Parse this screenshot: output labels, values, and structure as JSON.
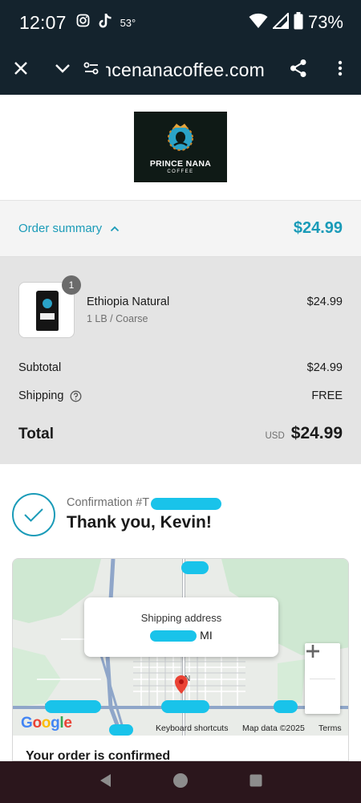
{
  "status_bar": {
    "time": "12:07",
    "temperature": "53°",
    "battery": "73%",
    "icons": [
      "instagram-icon",
      "tiktok-icon",
      "wifi-icon",
      "signal-icon",
      "battery-icon"
    ]
  },
  "browser": {
    "url": "princenanacoffee.com",
    "icons": [
      "close-icon",
      "chevron-down-icon",
      "site-settings-icon",
      "share-icon",
      "more-vert-icon"
    ]
  },
  "logo": {
    "name": "PRINCE NANA",
    "sub": "COFFEE"
  },
  "summary": {
    "toggle_label": "Order summary",
    "toggle_total": "$24.99",
    "product": {
      "name": "Ethiopia Natural",
      "variant": "1 LB / Coarse",
      "price": "$24.99",
      "quantity": "1"
    },
    "subtotal_label": "Subtotal",
    "subtotal_value": "$24.99",
    "shipping_label": "Shipping",
    "shipping_value": "FREE",
    "total_label": "Total",
    "total_currency": "USD",
    "total_value": "$24.99"
  },
  "confirmation": {
    "number_prefix": "Confirmation #T",
    "thanks": "Thank you, Kevin!"
  },
  "map": {
    "address_title": "Shipping address",
    "address_value": "MI",
    "google": [
      "G",
      "o",
      "o",
      "g",
      "l",
      "e"
    ],
    "keyboard_shortcuts": "Keyboard shortcuts",
    "map_data": "Map data ©2025",
    "terms": "Terms",
    "road_labels": [
      "N",
      "N",
      "W"
    ]
  },
  "order_confirmed": "Your order is confirmed",
  "colors": {
    "accent": "#1a9bb8",
    "status_bg": "#14232d",
    "nav_bg": "#2b161c",
    "panel_bg": "#e4e4e4",
    "redaction": "#19c3ea"
  }
}
